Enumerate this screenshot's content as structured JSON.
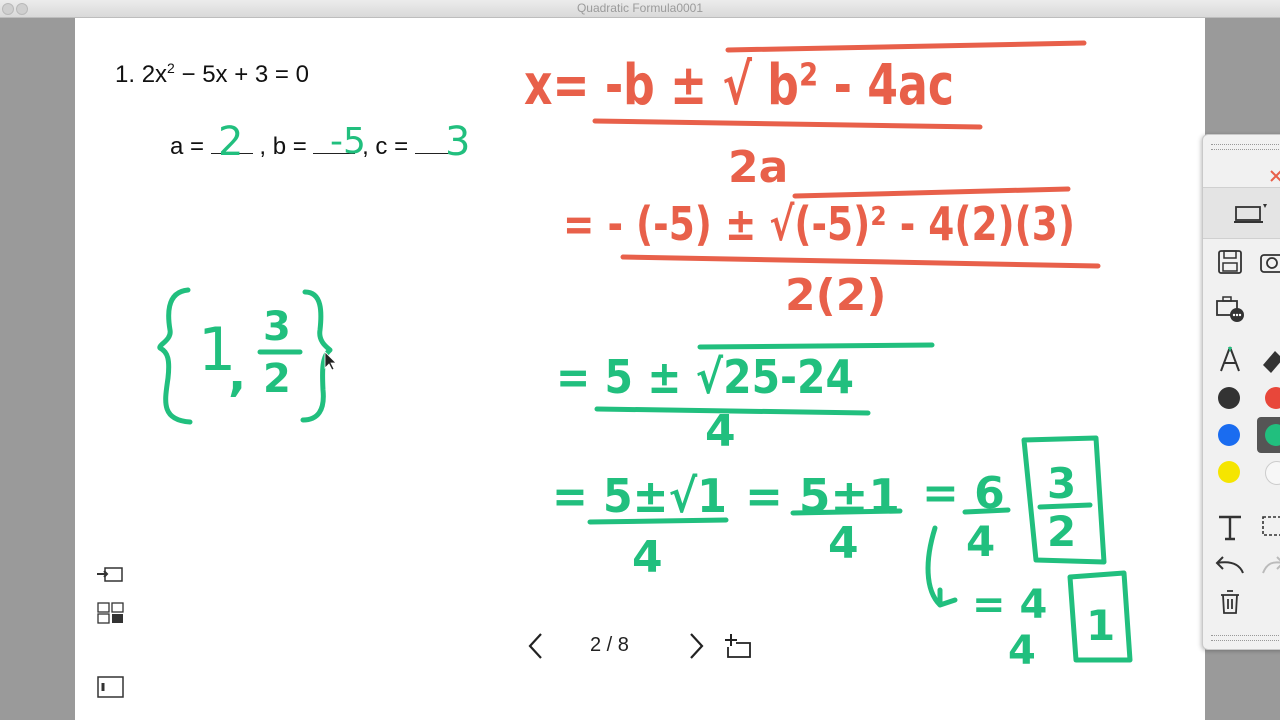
{
  "window": {
    "title": "Quadratic Formula0001"
  },
  "problem": {
    "number": "1.",
    "equation_lhs": "2x",
    "exponent": "2",
    "equation_rest": " − 5x + 3 = 0"
  },
  "coefficients": {
    "a_label": "a =",
    "a_value": "2",
    "b_label": ", b =",
    "b_value": "-5",
    "c_label": ", c =",
    "c_value": "3"
  },
  "work": {
    "formula": "x= -b ± √ b² - 4ac",
    "formula_den": "2a",
    "step1": "= - (-5) ± √(-5)² - 4(2)(3)",
    "step1_den": "2(2)",
    "step2": "= 5 ± √25-24",
    "step2_den": "4",
    "step3_a": "= 5±√1",
    "step3_a_den": "4",
    "step3_b": "= 5±1",
    "step3_b_den": "4",
    "step3_c": "= 6",
    "step3_c_den": "4",
    "step3_d": "3",
    "step3_d_den": "2",
    "step4_a": "= 4",
    "step4_a_den": "4",
    "step4_b": "1",
    "solution_set": "{ 1 , 3/2 }",
    "sol_one": "1",
    "sol_comma": ",",
    "sol_num": "3",
    "sol_den": "2"
  },
  "navigation": {
    "page": "2 / 8"
  },
  "colors": {
    "red_ink": "#e8604a",
    "green_ink": "#21bf7e"
  }
}
